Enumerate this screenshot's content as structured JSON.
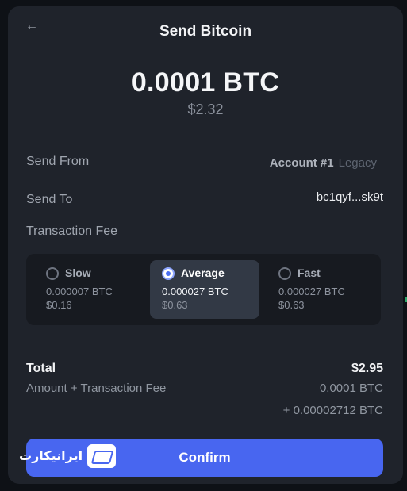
{
  "header": {
    "title": "Send Bitcoin",
    "back_icon": "arrow-left-icon"
  },
  "amount": {
    "btc": "0.0001 BTC",
    "usd": "$2.32"
  },
  "details": {
    "send_from_label": "Send From",
    "account_name": "Account #1",
    "account_type": "Legacy",
    "send_to_label": "Send To",
    "send_to_address": "bc1qyf...sk9t",
    "fee_label": "Transaction Fee"
  },
  "fees": [
    {
      "name": "Slow",
      "btc": "0.000007 BTC",
      "usd": "$0.16",
      "selected": false
    },
    {
      "name": "Average",
      "btc": "0.000027 BTC",
      "usd": "$0.63",
      "selected": true
    },
    {
      "name": "Fast",
      "btc": "0.000027 BTC",
      "usd": "$0.63",
      "selected": false
    }
  ],
  "total": {
    "label": "Total",
    "value": "$2.95",
    "sub_label": "Amount + Transaction Fee",
    "amount_btc": "0.0001 BTC",
    "fee_btc": "+ 0.00002712 BTC"
  },
  "confirm_label": "Confirm",
  "watermark": {
    "text": "ایرانیکارت",
    "icon": "card-logo-icon"
  },
  "colors": {
    "accent": "#4866f0",
    "panel": "#1f232b",
    "selected_option": "#323945"
  }
}
